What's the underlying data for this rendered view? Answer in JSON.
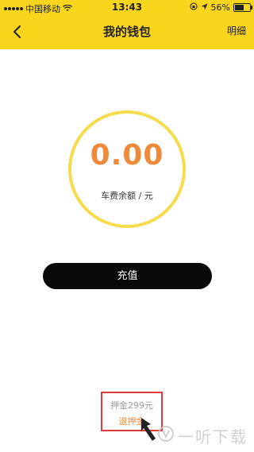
{
  "status_bar": {
    "carrier": "中国移动",
    "time": "13:43",
    "battery": "56%"
  },
  "nav": {
    "title": "我的钱包",
    "detail_label": "明细"
  },
  "wallet": {
    "balance": "0.00",
    "balance_label": "车费余额 / 元"
  },
  "actions": {
    "recharge_label": "充值"
  },
  "deposit": {
    "amount_text": "押金299元",
    "refund_label": "退押金"
  },
  "watermark": {
    "text": "一听下载"
  },
  "colors": {
    "header": "#f9d51e",
    "ring": "#f6dc4c",
    "amount": "#ee8a3c",
    "button": "#0a0a0a",
    "highlight_box": "#e03b3b"
  }
}
